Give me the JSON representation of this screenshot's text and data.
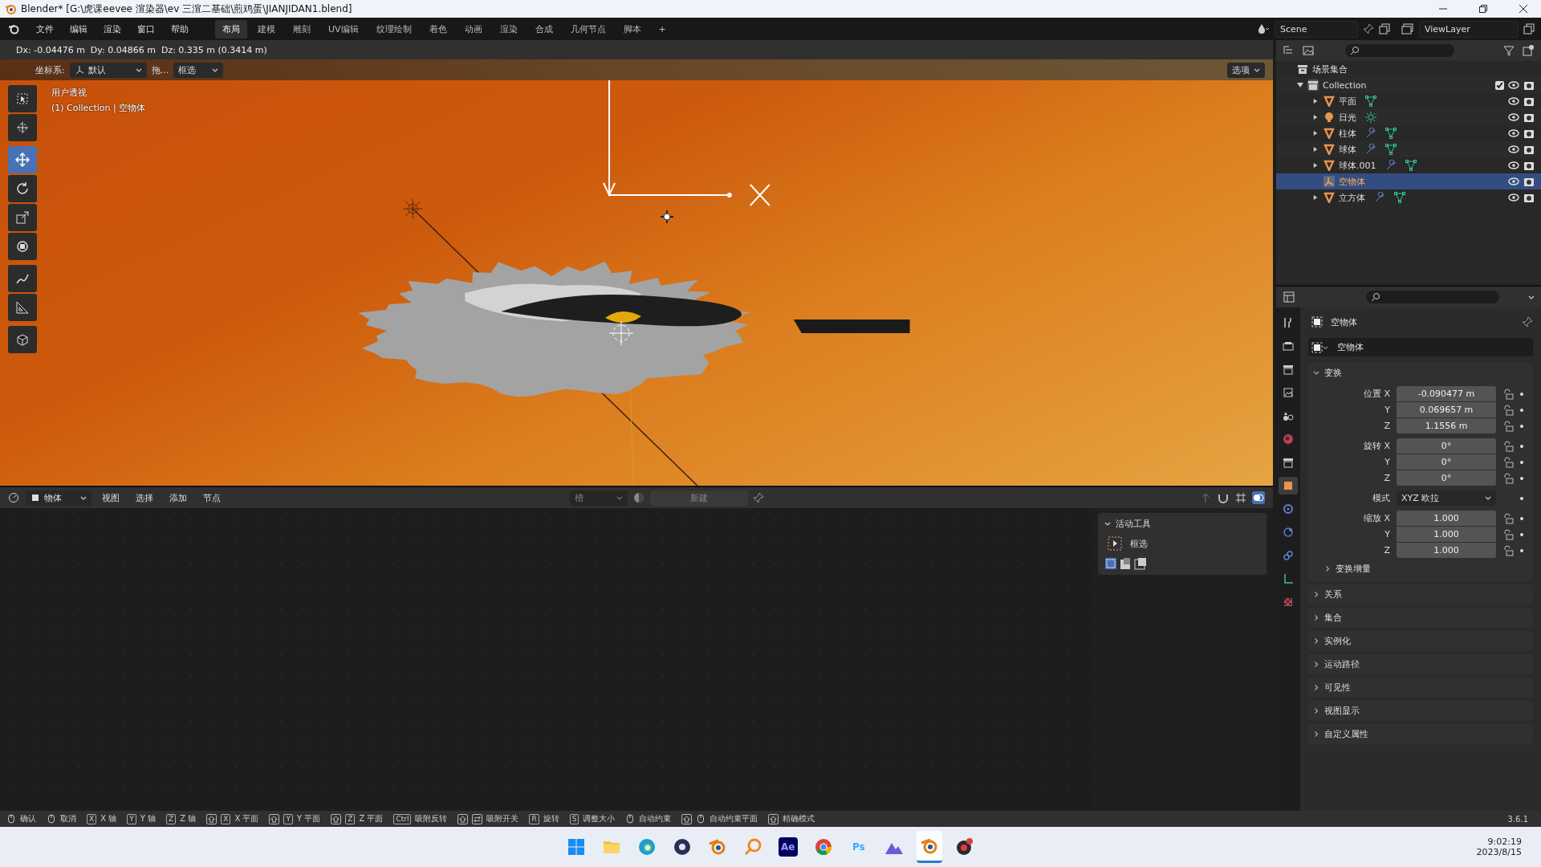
{
  "window": {
    "title": "Blender* [G:\\虎课eevee 渲染器\\ev 三渲二基础\\煎鸡蛋\\JIANJIDAN1.blend]"
  },
  "menu": [
    "文件",
    "编辑",
    "渲染",
    "窗口",
    "帮助"
  ],
  "workspaces": [
    {
      "label": "布局",
      "selected": true
    },
    {
      "label": "建模",
      "selected": false
    },
    {
      "label": "雕刻",
      "selected": false
    },
    {
      "label": "UV编辑",
      "selected": false
    },
    {
      "label": "纹理绘制",
      "selected": false
    },
    {
      "label": "着色",
      "selected": false
    },
    {
      "label": "动画",
      "selected": false
    },
    {
      "label": "渲染",
      "selected": false
    },
    {
      "label": "合成",
      "selected": false
    },
    {
      "label": "几何节点",
      "selected": false
    },
    {
      "label": "脚本",
      "selected": false
    }
  ],
  "add_workspace": "+",
  "scene": "Scene",
  "view_layer": "ViewLayer",
  "viewport": {
    "readout": "Dx: -0.04476 m  Dy: 0.04866 m  Dz: 0.335 m (0.3414 m)",
    "orientation_label": "坐标系:",
    "orientation_value": "默认",
    "drag_label": "拖...",
    "select_mode": "框选",
    "options": "选项",
    "view_name": "用户透视",
    "context": "(1) Collection | 空物体",
    "tools": [
      {
        "kind": "select",
        "selected": false
      },
      {
        "kind": "cursor",
        "selected": false
      },
      {
        "kind": "move",
        "selected": true
      },
      {
        "kind": "rotate",
        "selected": false
      },
      {
        "kind": "scale",
        "selected": false
      },
      {
        "kind": "transform",
        "selected": false
      },
      {
        "kind": "annotate",
        "selected": false
      },
      {
        "kind": "measure",
        "selected": false
      },
      {
        "kind": "add-cube",
        "selected": false
      }
    ]
  },
  "outliner": {
    "root": "场景集合",
    "collection": {
      "name": "Collection",
      "expanded": true,
      "checked": true,
      "children": [
        {
          "name": "平面",
          "kind": "mesh",
          "modifier": false,
          "selected": false
        },
        {
          "name": "日光",
          "kind": "light",
          "modifier": false,
          "selected": false
        },
        {
          "name": "柱体",
          "kind": "mesh",
          "modifier": true,
          "selected": false
        },
        {
          "name": "球体",
          "kind": "mesh",
          "modifier": true,
          "selected": false
        },
        {
          "name": "球体.001",
          "kind": "mesh",
          "modifier": true,
          "selected": false
        },
        {
          "name": "空物体",
          "kind": "empty",
          "modifier": false,
          "selected": true
        },
        {
          "name": "立方体",
          "kind": "mesh",
          "modifier": true,
          "selected": false
        }
      ]
    }
  },
  "properties": {
    "tabs": [
      {
        "kind": "tool",
        "selected": false
      },
      {
        "kind": "render",
        "selected": false
      },
      {
        "kind": "output",
        "selected": false
      },
      {
        "kind": "view-layer",
        "selected": false
      },
      {
        "kind": "scene",
        "selected": false
      },
      {
        "kind": "world",
        "selected": false
      },
      {
        "kind": "collection",
        "selected": false
      },
      {
        "kind": "object",
        "selected": true
      },
      {
        "kind": "modifier",
        "selected": false
      },
      {
        "kind": "physics",
        "selected": false
      },
      {
        "kind": "constraint",
        "selected": false
      },
      {
        "kind": "data",
        "selected": false
      },
      {
        "kind": "texture",
        "selected": false
      }
    ],
    "header": "空物体",
    "name": "空物体",
    "transform": {
      "title": "变换",
      "expanded": true,
      "rows": [
        {
          "kind": "vector",
          "label": "位置",
          "fields": [
            {
              "axis": "X",
              "value": "-0.090477 m"
            },
            {
              "axis": "Y",
              "value": "0.069657 m"
            },
            {
              "axis": "Z",
              "value": "1.1556 m"
            }
          ]
        },
        {
          "kind": "vector",
          "label": "旋转",
          "fields": [
            {
              "axis": "X",
              "value": "0°"
            },
            {
              "axis": "Y",
              "value": "0°"
            },
            {
              "axis": "Z",
              "value": "0°"
            }
          ]
        },
        {
          "kind": "dropdown",
          "label": "模式",
          "value": "XYZ 欧拉"
        },
        {
          "kind": "vector",
          "label": "缩放",
          "fields": [
            {
              "axis": "X",
              "value": "1.000"
            },
            {
              "axis": "Y",
              "value": "1.000"
            },
            {
              "axis": "Z",
              "value": "1.000"
            }
          ]
        }
      ],
      "subpanel": "变换增量"
    },
    "panels": [
      {
        "title": "关系",
        "expanded": false
      },
      {
        "title": "集合",
        "expanded": false
      },
      {
        "title": "实例化",
        "expanded": false
      },
      {
        "title": "运动路径",
        "expanded": false
      },
      {
        "title": "可见性",
        "expanded": false
      },
      {
        "title": "视图显示",
        "expanded": false
      },
      {
        "title": "自定义属性",
        "expanded": false
      }
    ]
  },
  "node_editor": {
    "data_type": "物体",
    "menus": [
      "视图",
      "选择",
      "添加",
      "节点"
    ],
    "slot": "槽",
    "new_button": "新建",
    "sidebar": {
      "panel": "活动工具",
      "expanded": true,
      "tool": "框选"
    }
  },
  "status_bar": {
    "items": [
      {
        "keys": [
          {
            "kind": "mouse"
          }
        ],
        "label": "确认"
      },
      {
        "keys": [
          {
            "kind": "mouse"
          }
        ],
        "label": "取消"
      },
      {
        "keys": [
          {
            "kind": "key",
            "text": "X"
          }
        ],
        "label": "X 轴"
      },
      {
        "keys": [
          {
            "kind": "key",
            "text": "Y"
          }
        ],
        "label": "Y 轴"
      },
      {
        "keys": [
          {
            "kind": "key",
            "text": "Z"
          }
        ],
        "label": "Z 轴"
      },
      {
        "keys": [
          {
            "kind": "shift"
          },
          {
            "kind": "key",
            "text": "X"
          }
        ],
        "label": "X 平面"
      },
      {
        "keys": [
          {
            "kind": "shift"
          },
          {
            "kind": "key",
            "text": "Y"
          }
        ],
        "label": "Y 平面"
      },
      {
        "keys": [
          {
            "kind": "shift"
          },
          {
            "kind": "key",
            "text": "Z"
          }
        ],
        "label": "Z 平面"
      },
      {
        "keys": [
          {
            "kind": "key",
            "text": "Ctrl"
          }
        ],
        "label": "吸附反转"
      },
      {
        "keys": [
          {
            "kind": "shift"
          },
          {
            "kind": "tab"
          }
        ],
        "label": "吸附开关"
      },
      {
        "keys": [
          {
            "kind": "key",
            "text": "R"
          }
        ],
        "label": "旋转"
      },
      {
        "keys": [
          {
            "kind": "key",
            "text": "S"
          }
        ],
        "label": "调整大小"
      },
      {
        "keys": [
          {
            "kind": "mouse"
          }
        ],
        "label": "自动约束"
      },
      {
        "keys": [
          {
            "kind": "shift"
          },
          {
            "kind": "mouse"
          }
        ],
        "label": "自动约束平面"
      },
      {
        "keys": [
          {
            "kind": "shift"
          }
        ],
        "label": "精确模式"
      }
    ],
    "version": "3.6.1"
  },
  "taskbar": {
    "apps": [
      {
        "kind": "start",
        "active": false
      },
      {
        "kind": "folder",
        "active": false
      },
      {
        "kind": "edge",
        "active": false
      },
      {
        "kind": "disc",
        "active": false
      },
      {
        "kind": "blender",
        "active": false
      },
      {
        "kind": "search",
        "active": false
      },
      {
        "kind": "ae",
        "label": "Ae",
        "active": false
      },
      {
        "kind": "chrome",
        "active": false
      },
      {
        "kind": "ps",
        "label": "Ps",
        "active": false
      },
      {
        "kind": "mountain",
        "active": false
      },
      {
        "kind": "blender",
        "active": true
      },
      {
        "kind": "dot",
        "active": false
      }
    ],
    "time": "9:02:19",
    "date": "2023/8/15"
  }
}
